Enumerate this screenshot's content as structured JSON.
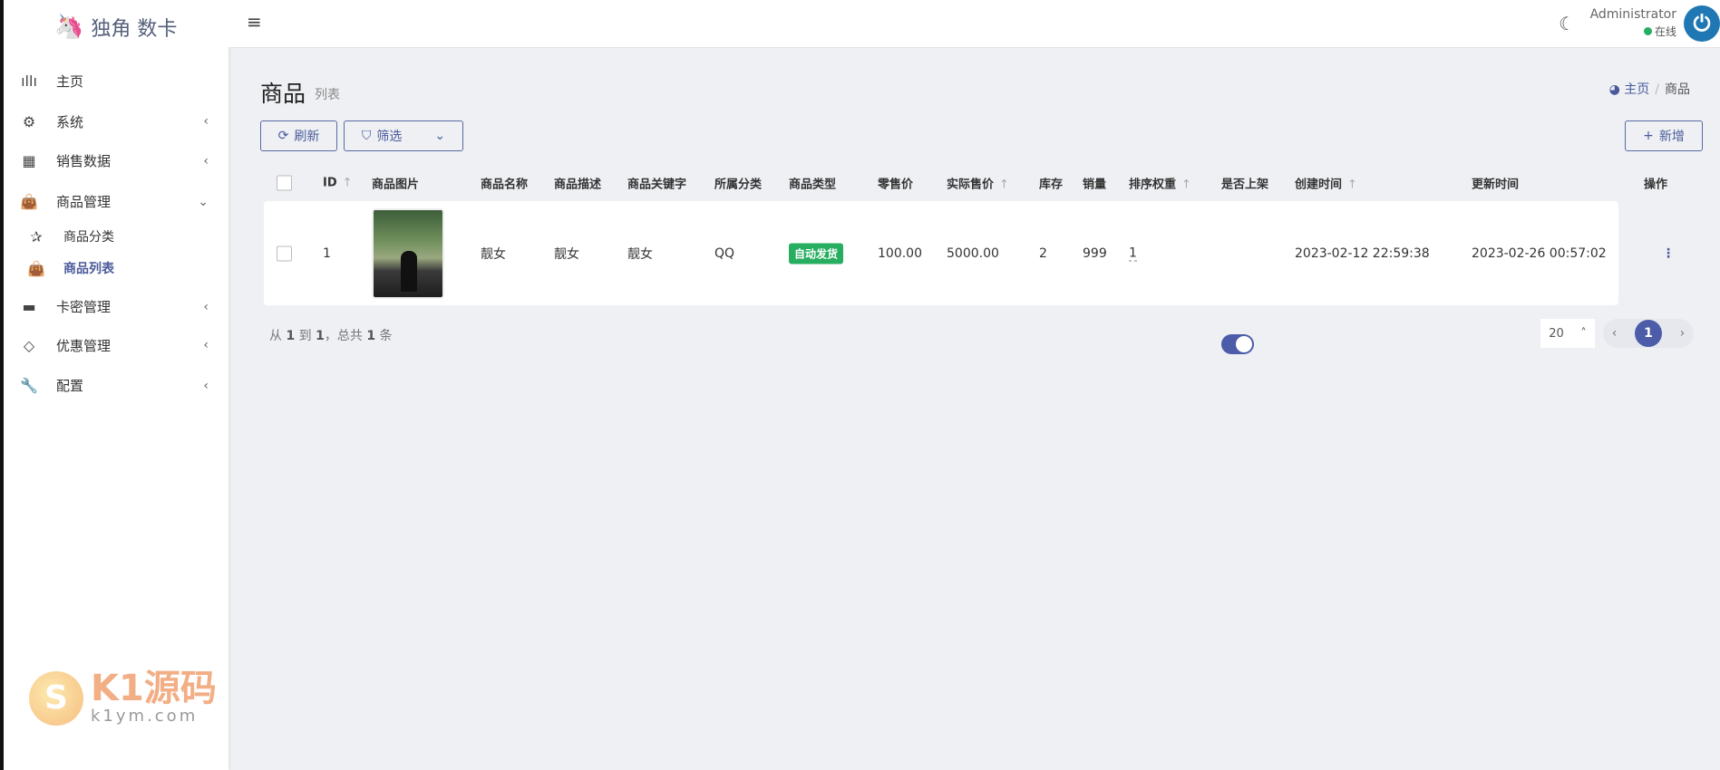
{
  "brand": {
    "name": "独角 数卡"
  },
  "sidebar": {
    "items": [
      {
        "label": "主页",
        "icon": "bar-chart-icon",
        "glyph": "ıllı",
        "chev": ""
      },
      {
        "label": "系统",
        "icon": "gear-icon",
        "glyph": "⚙",
        "chev": "‹"
      },
      {
        "label": "销售数据",
        "icon": "table-icon",
        "glyph": "▦",
        "chev": "‹"
      },
      {
        "label": "商品管理",
        "icon": "shopping-bag-icon",
        "glyph": "👜",
        "chev": "⌄"
      },
      {
        "label": "商品分类",
        "icon": "star-icon",
        "glyph": "✰",
        "chev": ""
      },
      {
        "label": "商品列表",
        "icon": "shopping-bag-icon",
        "glyph": "👜",
        "chev": ""
      },
      {
        "label": "卡密管理",
        "icon": "credit-card-icon",
        "glyph": "▬",
        "chev": "‹"
      },
      {
        "label": "优惠管理",
        "icon": "diamond-icon",
        "glyph": "◇",
        "chev": "‹"
      },
      {
        "label": "配置",
        "icon": "wrench-icon",
        "glyph": "🔧",
        "chev": "‹"
      }
    ]
  },
  "header": {
    "user": "Administrator",
    "status": "在线"
  },
  "page": {
    "title": "商品",
    "subtitle": "列表",
    "breadcrumb": [
      "主页",
      "商品"
    ]
  },
  "toolbar": {
    "refresh": "刷新",
    "filter": "筛选",
    "add": "新增"
  },
  "table": {
    "columns": [
      "ID",
      "商品图片",
      "商品名称",
      "商品描述",
      "商品关键字",
      "所属分类",
      "商品类型",
      "零售价",
      "实际售价",
      "库存",
      "销量",
      "排序权重",
      "是否上架",
      "创建时间",
      "更新时间",
      "操作"
    ],
    "rows": [
      {
        "id": "1",
        "name": "靓女",
        "desc": "靓女",
        "keywords": "靓女",
        "category": "QQ",
        "type": "自动发货",
        "retail_price": "100.00",
        "actual_price": "5000.00",
        "stock": "2",
        "sales": "999",
        "weight": "1",
        "on_sale": true,
        "created": "2023-02-12 22:59:38",
        "updated": "2023-02-26 00:57:02"
      }
    ]
  },
  "footer": {
    "p1": "从",
    "from": "1",
    "p2": "到",
    "to": "1",
    "p3": "，总共",
    "total": "1",
    "p4": "条",
    "page_size": "20",
    "current_page": "1"
  },
  "watermark": {
    "text": "K1源码",
    "url": "k1ym.com"
  },
  "colors": {
    "accent": "#4c5ca8",
    "success": "#27ae60"
  }
}
